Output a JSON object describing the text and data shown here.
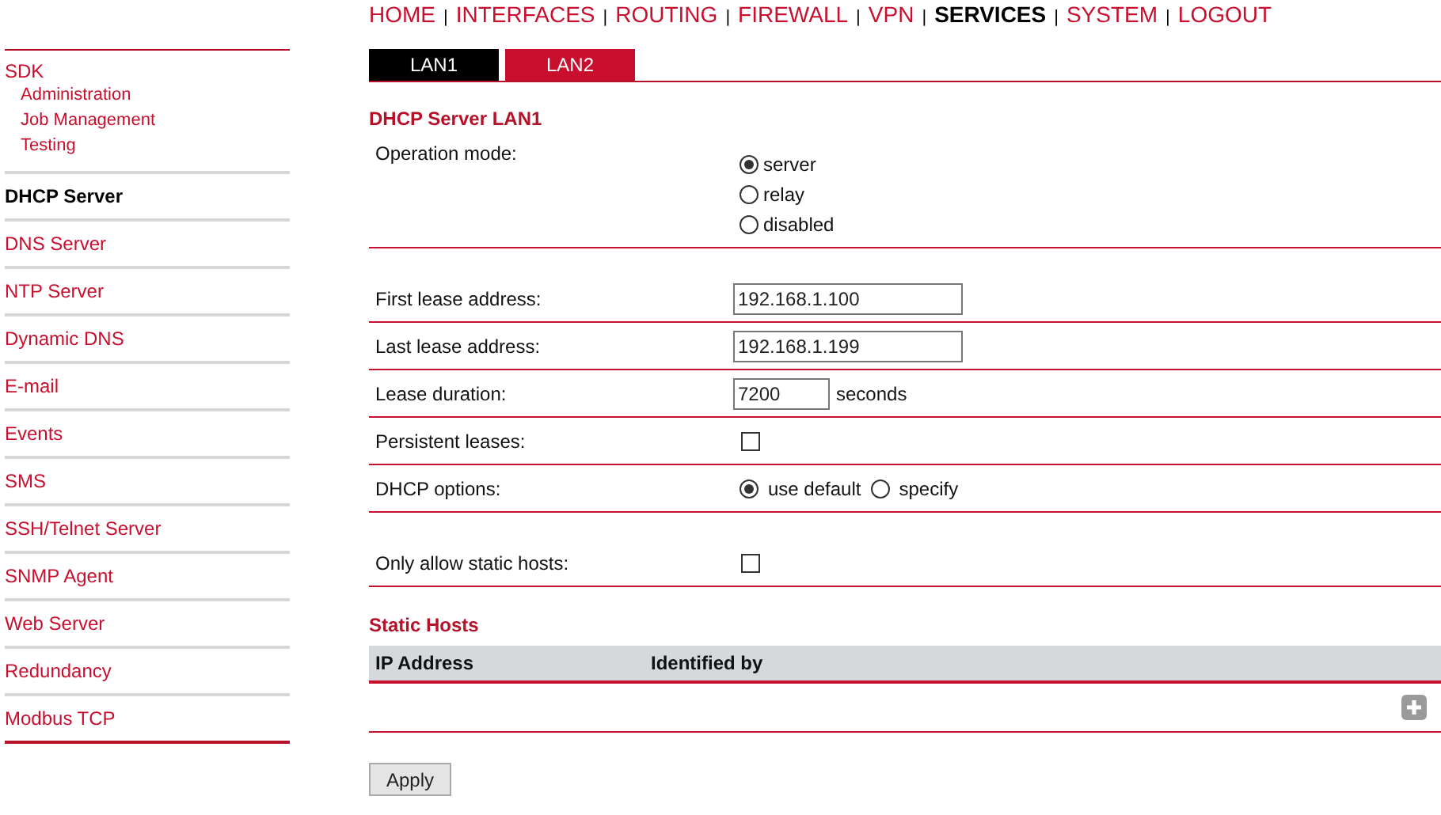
{
  "nav": [
    {
      "label": "HOME",
      "selected": false
    },
    {
      "label": "INTERFACES",
      "selected": false
    },
    {
      "label": "ROUTING",
      "selected": false
    },
    {
      "label": "FIREWALL",
      "selected": false
    },
    {
      "label": "VPN",
      "selected": false
    },
    {
      "label": "SERVICES",
      "selected": true
    },
    {
      "label": "SYSTEM",
      "selected": false
    },
    {
      "label": "LOGOUT",
      "selected": false
    }
  ],
  "nav_separator": "|",
  "sidebar": {
    "items": [
      {
        "label": "SDK",
        "selected": false,
        "children": [
          {
            "label": "Administration",
            "selected": false
          },
          {
            "label": "Job Management",
            "selected": false
          },
          {
            "label": "Testing",
            "selected": false
          }
        ]
      },
      {
        "label": "DHCP Server",
        "selected": true
      },
      {
        "label": "DNS Server",
        "selected": false
      },
      {
        "label": "NTP Server",
        "selected": false
      },
      {
        "label": "Dynamic DNS",
        "selected": false
      },
      {
        "label": "E-mail",
        "selected": false
      },
      {
        "label": "Events",
        "selected": false
      },
      {
        "label": "SMS",
        "selected": false
      },
      {
        "label": "SSH/Telnet Server",
        "selected": false
      },
      {
        "label": "SNMP Agent",
        "selected": false
      },
      {
        "label": "Web Server",
        "selected": false
      },
      {
        "label": "Redundancy",
        "selected": false
      },
      {
        "label": "Modbus TCP",
        "selected": false
      }
    ]
  },
  "tabs": [
    {
      "label": "LAN1",
      "selected": true
    },
    {
      "label": "LAN2",
      "selected": false
    }
  ],
  "section_title": "DHCP Server LAN1",
  "form_groups": [
    {
      "rows": [
        {
          "kind": "radio-group",
          "label": "Operation mode:",
          "options": [
            {
              "label": "server",
              "selected": true
            },
            {
              "label": "relay",
              "selected": false
            },
            {
              "label": "disabled",
              "selected": false
            }
          ]
        }
      ]
    },
    {
      "rows": [
        {
          "kind": "text",
          "label": "First lease address:",
          "value": "192.168.1.100"
        },
        {
          "kind": "text",
          "label": "Last lease address:",
          "value": "192.168.1.199"
        },
        {
          "kind": "text-unit",
          "label": "Lease duration:",
          "value": "7200",
          "unit": "seconds"
        },
        {
          "kind": "checkbox",
          "label": "Persistent leases:",
          "checked": false
        },
        {
          "kind": "radio-inline",
          "label": "DHCP options:",
          "options": [
            {
              "label": "use default",
              "selected": true
            },
            {
              "label": "specify",
              "selected": false
            }
          ]
        }
      ]
    },
    {
      "rows": [
        {
          "kind": "checkbox",
          "label": "Only allow static hosts:",
          "checked": false
        }
      ]
    }
  ],
  "static_hosts": {
    "title": "Static Hosts",
    "columns": [
      "IP Address",
      "Identified by"
    ]
  },
  "buttons": [
    "Apply"
  ]
}
